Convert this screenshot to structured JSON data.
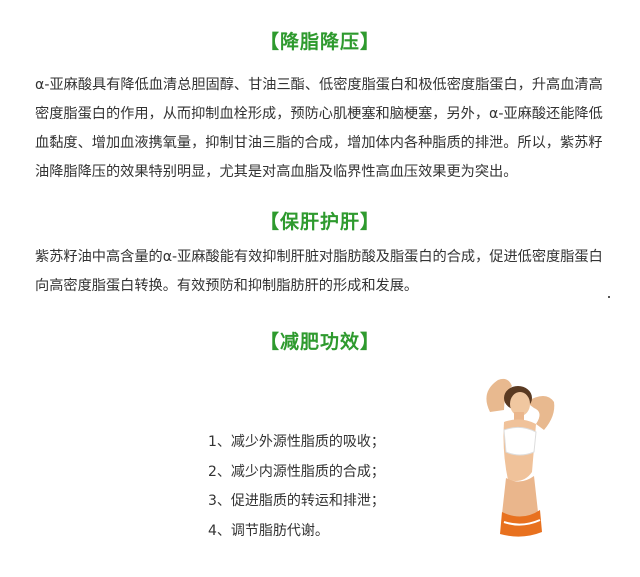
{
  "sections": [
    {
      "title": "【降脂降压】",
      "paragraph": "α-亚麻酸具有降低血清总胆固醇、甘油三酯、低密度脂蛋白和极低密度脂蛋白，升高血清高密度脂蛋白的作用，从而抑制血栓形成，预防心肌梗塞和脑梗塞，另外，α-亚麻酸还能降低血黏度、增加血液携氧量，抑制甘油三脂的合成，增加体内各种脂质的排泄。所以，紫苏籽油降脂降压的效果特别明显，尤其是对高血脂及临界性高血压效果更为突出。"
    },
    {
      "title": "【保肝护肝】",
      "paragraph": "紫苏籽油中高含量的α-亚麻酸能有效抑制肝脏对脂肪酸及脂蛋白的合成，促进低密度脂蛋白向高密度脂蛋白转换。有效预防和抑制脂肪肝的形成和发展。"
    },
    {
      "title": "【减肥功效】",
      "items": [
        "1、减少外源性脂质的吸收；",
        "2、减少内源性脂质的合成；",
        "3、促进脂质的转运和排泄；",
        "4、调节脂肪代谢。"
      ]
    }
  ],
  "colors": {
    "title_green": "#2e9a2e",
    "body_text": "#333333",
    "swimsuit_orange": "#e8711f"
  },
  "icons": {
    "figure": "woman-illustration-icon"
  }
}
